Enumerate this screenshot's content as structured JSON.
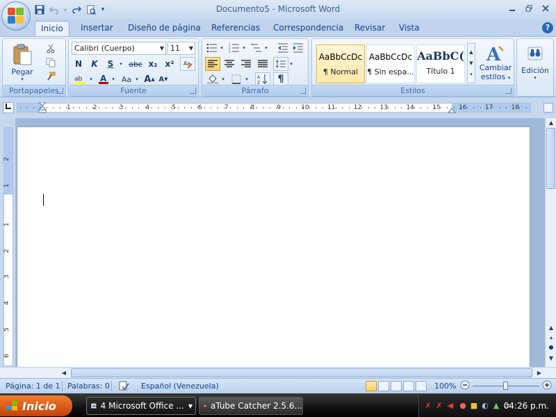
{
  "window": {
    "title": "Documento5 - Microsoft Word"
  },
  "quick_access": {
    "items": [
      "save-icon",
      "undo-icon",
      "redo-icon",
      "print-preview-icon",
      "customize-icon"
    ]
  },
  "tabs": [
    {
      "label": "Inicio",
      "active": true
    },
    {
      "label": "Insertar",
      "active": false
    },
    {
      "label": "Diseño de página",
      "active": false
    },
    {
      "label": "Referencias",
      "active": false
    },
    {
      "label": "Correspondencia",
      "active": false
    },
    {
      "label": "Revisar",
      "active": false
    },
    {
      "label": "Vista",
      "active": false
    }
  ],
  "ribbon": {
    "clipboard": {
      "group_label": "Portapapeles",
      "paste_label": "Pegar"
    },
    "font": {
      "group_label": "Fuente",
      "font_name": "Calibri (Cuerpo)",
      "font_size": "11",
      "bold": "N",
      "italic": "K",
      "underline": "S",
      "strikethrough": "abc",
      "subscript": "x₂",
      "superscript": "x²",
      "change_case": "Aa",
      "grow_font": "A",
      "shrink_font": "A"
    },
    "paragraph": {
      "group_label": "Párrafo"
    },
    "styles": {
      "group_label": "Estilos",
      "items": [
        {
          "sample": "AaBbCcDc",
          "name": "¶ Normal",
          "selected": true
        },
        {
          "sample": "AaBbCcDc",
          "name": "¶ Sin espa...",
          "selected": false
        },
        {
          "sample": "AaBbC(",
          "name": "Título 1",
          "selected": false
        }
      ],
      "change_styles_label_1": "Cambiar",
      "change_styles_label_2": "estilos"
    },
    "editing": {
      "label": "Edición"
    }
  },
  "ruler": {
    "numbers": [
      "2",
      "1",
      "1",
      "2",
      "3",
      "4",
      "5",
      "6",
      "7",
      "8",
      "9",
      "10",
      "11",
      "12",
      "13",
      "14",
      "15",
      "16",
      "17",
      "18"
    ],
    "vertical_numbers": [
      "2",
      "1",
      "1",
      "2",
      "3",
      "4",
      "5",
      "6"
    ]
  },
  "statusbar": {
    "page": "Página: 1 de 1",
    "words": "Palabras: 0",
    "language": "Español (Venezuela)",
    "zoom": "100%"
  },
  "taskbar": {
    "start_label": "Inicio",
    "tasks": [
      {
        "label": "4 Microsoft Office ...",
        "active": true
      },
      {
        "label": "aTube Catcher 2.5.6...",
        "active": false
      }
    ],
    "clock": "04:26 p.m."
  },
  "colors": {
    "accent": "#15428b",
    "ribbon_bg": "#d8e6f6",
    "taskbar": "#111111",
    "start_button": "#e0621c"
  }
}
